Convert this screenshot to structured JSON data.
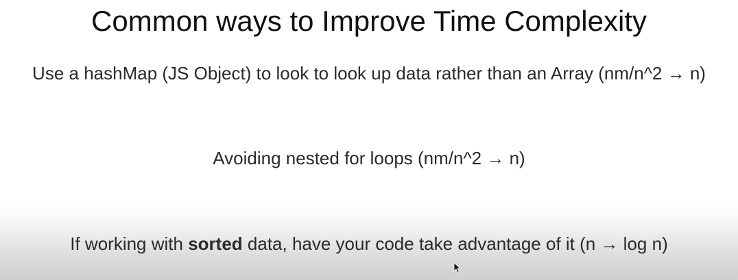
{
  "slide": {
    "title": "Common ways to Improve Time Complexity",
    "points": [
      {
        "text": "Use a hashMap (JS Object) to look to look up data rather than an Array (nm/n^2 → n)"
      },
      {
        "text": "Avoiding nested for loops (nm/n^2 → n)"
      },
      {
        "prefix": "If working with ",
        "emphasis": "sorted",
        "suffix": " data, have your code take advantage of it (n → log n)"
      }
    ]
  },
  "icons": {
    "cursor": "mouse-pointer-icon"
  },
  "colors": {
    "background": "#ffffff",
    "title_text": "#111111",
    "body_text": "#2a2a2a"
  }
}
